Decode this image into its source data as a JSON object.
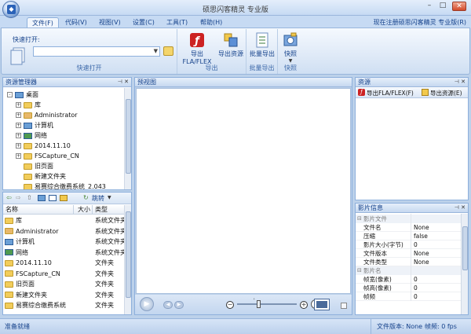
{
  "window": {
    "title": "硕思闪客精灵 专业版",
    "minimize": "–",
    "maximize": "□",
    "close": "✕"
  },
  "menu": {
    "tabs": [
      "文件(F)",
      "代码(V)",
      "视图(V)",
      "设置(C)",
      "工具(T)",
      "帮助(H)"
    ],
    "register": "现在注册硕思闪客精灵 专业版(R)"
  },
  "ribbon": {
    "quick_open": {
      "label": "快速打开:",
      "value": "",
      "group": "快速打开"
    },
    "export": {
      "fla_label": "导出FLA/FLEX",
      "res_label": "导出资源",
      "group": "导出"
    },
    "batch": {
      "label": "批量导出",
      "group": "批量导出"
    },
    "snapshot": {
      "label": "快照",
      "group": "快照"
    }
  },
  "explorer": {
    "title": "资源管理器",
    "tree": [
      {
        "label": "桌面",
        "level": 0,
        "expander": "-",
        "icon": "desktop"
      },
      {
        "label": "库",
        "level": 1,
        "expander": "+",
        "icon": "library"
      },
      {
        "label": "Administrator",
        "level": 1,
        "expander": "+",
        "icon": "user"
      },
      {
        "label": "计算机",
        "level": 1,
        "expander": "+",
        "icon": "computer"
      },
      {
        "label": "网络",
        "level": 1,
        "expander": "+",
        "icon": "network"
      },
      {
        "label": "2014.11.10",
        "level": 1,
        "expander": "+",
        "icon": "folder"
      },
      {
        "label": "FSCapture_CN",
        "level": 1,
        "expander": "+",
        "icon": "folder"
      },
      {
        "label": "旧页面",
        "level": 1,
        "expander": "",
        "icon": "folder"
      },
      {
        "label": "新建文件夹",
        "level": 1,
        "expander": "",
        "icon": "folder"
      },
      {
        "label": "易赛综合缴费系统_2.043",
        "level": 1,
        "expander": "",
        "icon": "folder"
      }
    ],
    "toolbar": {
      "jump": "跳转"
    },
    "list": {
      "columns": [
        "名称",
        "大小",
        "类型"
      ],
      "rows": [
        {
          "name": "库",
          "size": "",
          "type": "系统文件夹",
          "icon": "library"
        },
        {
          "name": "Administrator",
          "size": "",
          "type": "系统文件夹",
          "icon": "user"
        },
        {
          "name": "计算机",
          "size": "",
          "type": "系统文件夹",
          "icon": "computer"
        },
        {
          "name": "网络",
          "size": "",
          "type": "系统文件夹",
          "icon": "network"
        },
        {
          "name": "2014.11.10",
          "size": "",
          "type": "文件夹",
          "icon": "folder"
        },
        {
          "name": "FSCapture_CN",
          "size": "",
          "type": "文件夹",
          "icon": "folder"
        },
        {
          "name": "旧页面",
          "size": "",
          "type": "文件夹",
          "icon": "folder"
        },
        {
          "name": "新建文件夹",
          "size": "",
          "type": "文件夹",
          "icon": "folder"
        },
        {
          "name": "易赛综合缴费系统",
          "size": "",
          "type": "文件夹",
          "icon": "folder"
        }
      ]
    }
  },
  "preview": {
    "title": "预视图"
  },
  "resources": {
    "title": "资源",
    "export_fla": "导出FLA/FLEX(F)",
    "export_res": "导出资源(E)"
  },
  "movie_info": {
    "title": "影片信息",
    "sections": [
      {
        "name": "影片文件",
        "rows": [
          {
            "key": "文件名",
            "value": "None"
          },
          {
            "key": "压缩",
            "value": "false"
          },
          {
            "key": "影片大小(字节)",
            "value": "0"
          },
          {
            "key": "文件版本",
            "value": "None"
          },
          {
            "key": "文件类型",
            "value": "None"
          }
        ]
      },
      {
        "name": "影片名",
        "rows": [
          {
            "key": "帧宽(像素)",
            "value": "0"
          },
          {
            "key": "帧高(像素)",
            "value": "0"
          },
          {
            "key": "帧频",
            "value": "0"
          }
        ]
      }
    ]
  },
  "status": {
    "left": "准备就绪",
    "version": "文件版本: None",
    "fps": "帧频: 0 fps"
  },
  "colors": {
    "accent": "#15428b",
    "frame": "#bcd1ea"
  }
}
